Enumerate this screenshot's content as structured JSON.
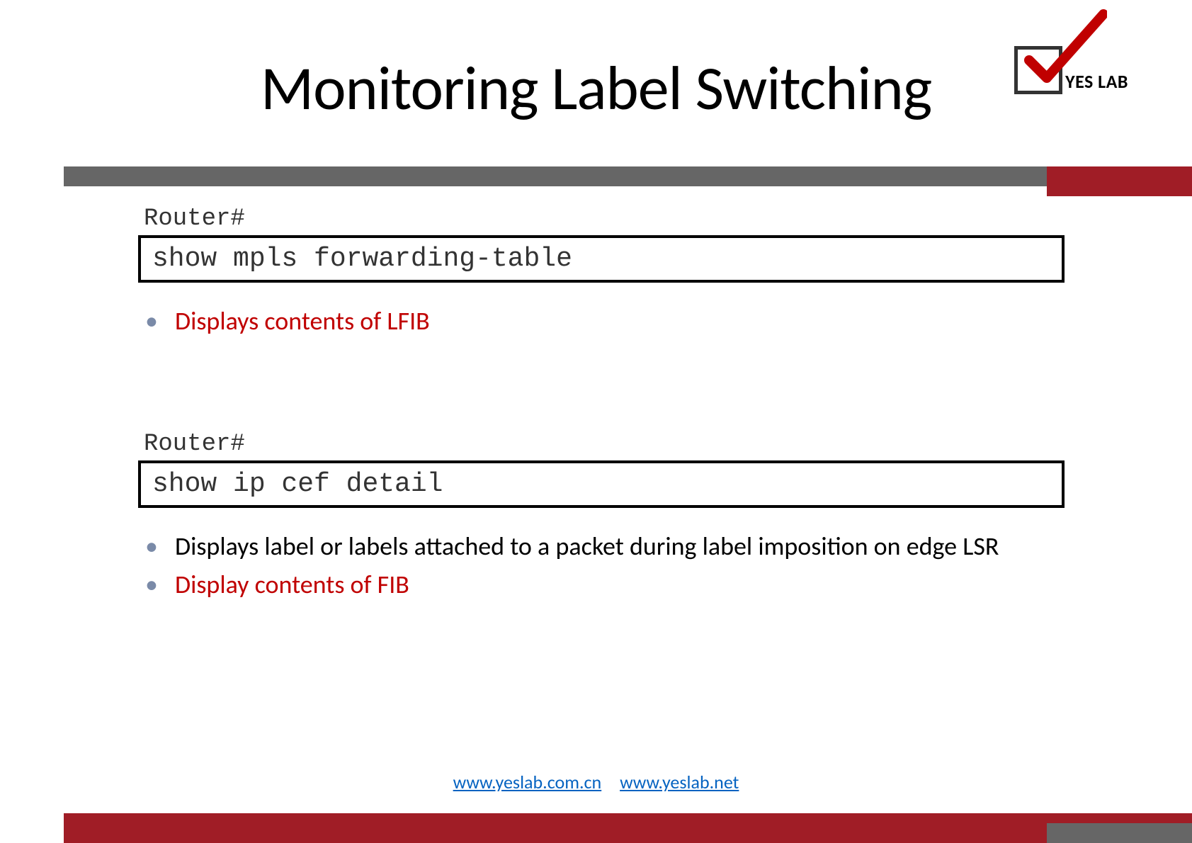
{
  "title": "Monitoring Label Switching",
  "logo": {
    "text": "YES LAB"
  },
  "section1": {
    "prompt": "Router#",
    "command": "show mpls forwarding-table",
    "bullets": [
      {
        "text": "Displays contents of LFIB",
        "style": "red"
      }
    ]
  },
  "section2": {
    "prompt": "Router#",
    "command": "show ip cef detail",
    "bullets": [
      {
        "text": "Displays label or labels attached to a packet during label imposition on edge LSR",
        "style": "black"
      },
      {
        "text": "Display contents of FIB",
        "style": "red"
      }
    ]
  },
  "footer": {
    "link1": "www.yeslab.com.cn",
    "link2": "www.yeslab.net"
  }
}
